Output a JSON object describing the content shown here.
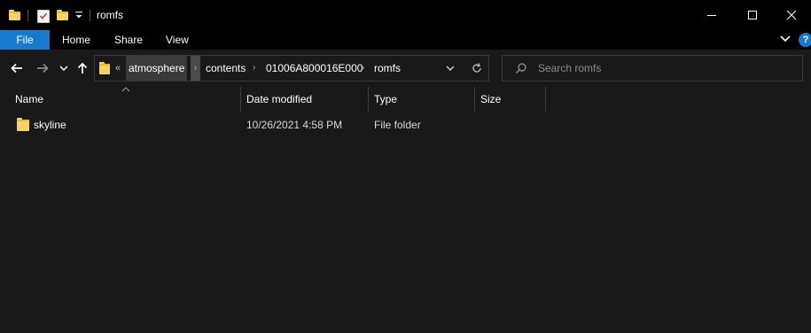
{
  "window": {
    "title": "romfs"
  },
  "ribbon": {
    "tabs": [
      {
        "label": "File"
      },
      {
        "label": "Home"
      },
      {
        "label": "Share"
      },
      {
        "label": "View"
      }
    ],
    "help_label": "?"
  },
  "address": {
    "overflow_marker": "«",
    "breadcrumbs": [
      {
        "label": "atmosphere"
      },
      {
        "label": "contents"
      },
      {
        "label": "01006A800016E000"
      },
      {
        "label": "romfs"
      }
    ],
    "separator": "›"
  },
  "search": {
    "placeholder": "Search romfs"
  },
  "file_list": {
    "columns": [
      {
        "label": "Name"
      },
      {
        "label": "Date modified"
      },
      {
        "label": "Type"
      },
      {
        "label": "Size"
      }
    ],
    "rows": [
      {
        "name": "skyline",
        "date_modified": "10/26/2021 4:58 PM",
        "type": "File folder",
        "size": ""
      }
    ]
  },
  "colors": {
    "accent": "#1979ca",
    "background": "#191919",
    "titlebar": "#000000",
    "folder": "#f7d26a"
  },
  "icons": {
    "folder": "folder-icon",
    "back": "back-arrow-icon",
    "forward": "forward-arrow-icon",
    "up": "up-arrow-icon",
    "recent": "recent-locations-chevron-icon",
    "refresh": "refresh-icon",
    "search": "search-icon",
    "minimize": "minimize-icon",
    "maximize": "maximize-icon",
    "close": "close-icon"
  }
}
